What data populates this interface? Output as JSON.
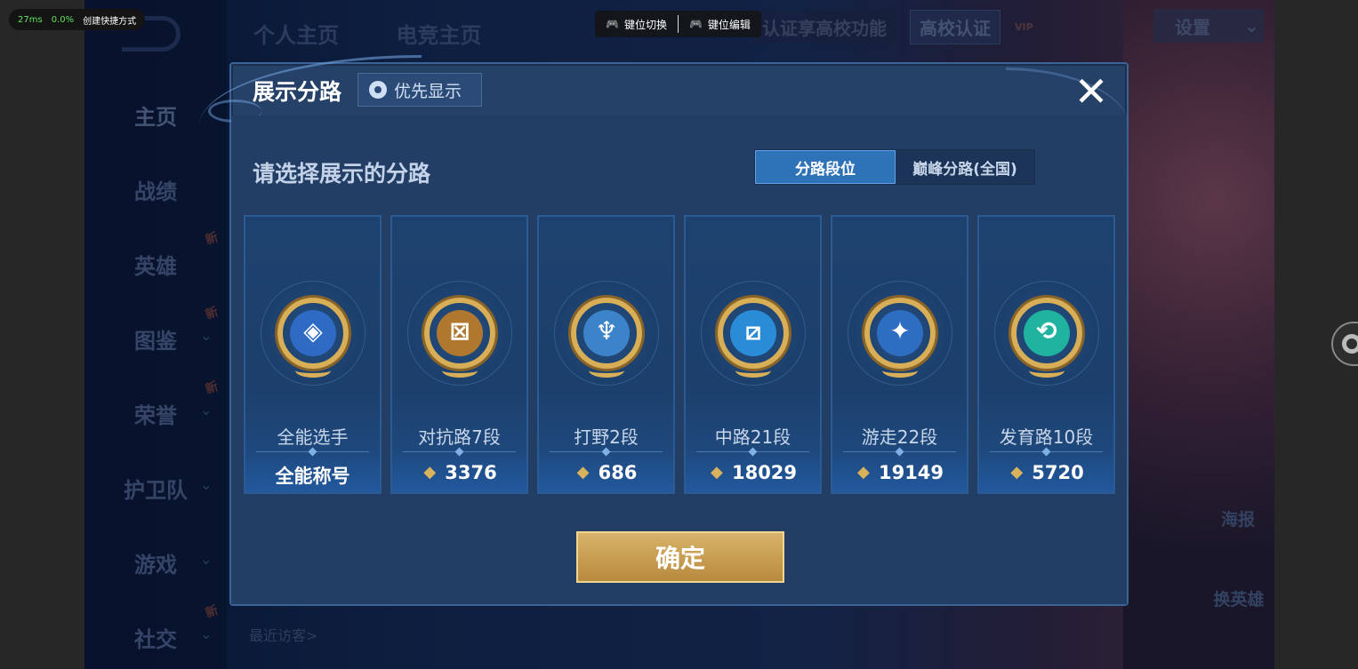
{
  "emulator": {
    "latency": "27ms",
    "cpu": "0.0%",
    "shortcut_label": "创建快捷方式",
    "key_switch": "键位切换",
    "key_edit": "键位编辑"
  },
  "background": {
    "tabs": [
      "个人主页",
      "电竞主页"
    ],
    "promo": "认证享高校功能",
    "cert": "高校认证",
    "vip": "VIP",
    "settings": "设置",
    "nav": [
      {
        "label": "主页",
        "new": false,
        "chevron": false
      },
      {
        "label": "战绩",
        "new": false,
        "chevron": false
      },
      {
        "label": "英雄",
        "new": true,
        "chevron": false
      },
      {
        "label": "图鉴",
        "new": true,
        "chevron": true
      },
      {
        "label": "荣誉",
        "new": true,
        "chevron": true
      },
      {
        "label": "护卫队",
        "new": false,
        "chevron": true
      },
      {
        "label": "游戏",
        "new": false,
        "chevron": true
      },
      {
        "label": "社交",
        "new": true,
        "chevron": true
      }
    ],
    "new_tag": "新",
    "recent_visitors": "最近访客>",
    "poster": "海报",
    "swap_hero": "换英雄"
  },
  "dialog": {
    "title": "展示分路",
    "priority_label": "优先显示",
    "prompt": "请选择展示的分路",
    "segments": [
      {
        "label": "分路段位",
        "active": true
      },
      {
        "label": "巅峰分路(全国)",
        "active": false
      }
    ],
    "cards": [
      {
        "name": "全能选手",
        "score": "全能称号",
        "show_icon": false,
        "badge_color": "#2f6bc4",
        "glyph": "◈"
      },
      {
        "name": "对抗路7段",
        "score": "3376",
        "show_icon": true,
        "badge_color": "#b0782e",
        "glyph": "⊠"
      },
      {
        "name": "打野2段",
        "score": "686",
        "show_icon": true,
        "badge_color": "#3c83c9",
        "glyph": "♆"
      },
      {
        "name": "中路21段",
        "score": "18029",
        "show_icon": true,
        "badge_color": "#2a8bd6",
        "glyph": "⧄"
      },
      {
        "name": "游走22段",
        "score": "19149",
        "show_icon": true,
        "badge_color": "#2d6ec2",
        "glyph": "✦"
      },
      {
        "name": "发育路10段",
        "score": "5720",
        "show_icon": true,
        "badge_color": "#1fb3a0",
        "glyph": "⟲"
      }
    ],
    "confirm": "确定",
    "close_icon": "close-icon"
  }
}
